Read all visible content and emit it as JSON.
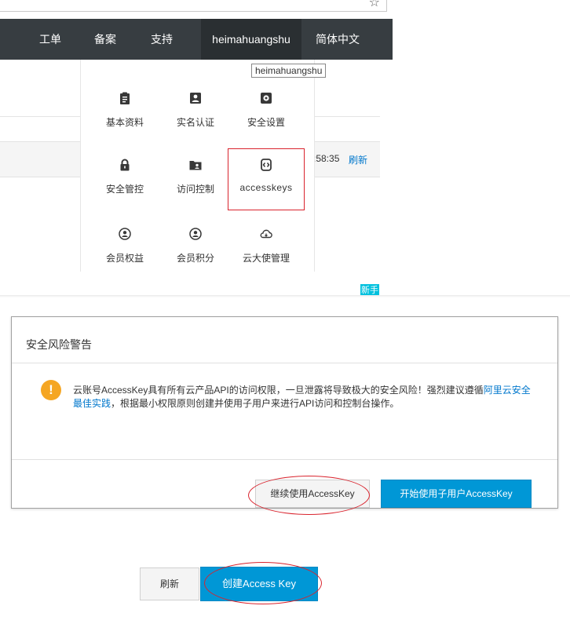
{
  "nav": {
    "items": [
      {
        "label": "工单"
      },
      {
        "label": "备案"
      },
      {
        "label": "支持"
      },
      {
        "label": "heimahuangshu"
      },
      {
        "label": "简体中文"
      }
    ],
    "bg_color": "#373d41"
  },
  "tooltip": "heimahuangshu",
  "menu": [
    {
      "label": "基本资料",
      "icon": "clipboard-icon"
    },
    {
      "label": "实名认证",
      "icon": "id-card-icon"
    },
    {
      "label": "安全设置",
      "icon": "gear-icon"
    },
    {
      "label": "安全管控",
      "icon": "lock-icon"
    },
    {
      "label": "访问控制",
      "icon": "folder-user-icon"
    },
    {
      "label": "accesskeys",
      "icon": "key-code-icon"
    },
    {
      "label": "会员权益",
      "icon": "member-icon"
    },
    {
      "label": "会员积分",
      "icon": "member-points-icon"
    },
    {
      "label": "云大使管理",
      "icon": "cloud-icon"
    }
  ],
  "background_row": {
    "time": ":58:35",
    "refresh": "刷新"
  },
  "new_badge": "新手",
  "dialog": {
    "title": "安全风险警告",
    "warning_icon": "!",
    "text_before_link": "云账号AccessKey具有所有云产品API的访问权限，一旦泄露将导致极大的安全风险！强烈建议遵循",
    "link": "阿里云安全最佳实践",
    "text_after_link": "，根据最小权限原则创建并使用子用户来进行API访问和控制台操作。",
    "continue_button": "继续使用AccessKey",
    "start_button": "开始使用子用户AccessKey"
  },
  "bottom": {
    "refresh_button": "刷新",
    "create_button": "创建Access Key"
  },
  "colors": {
    "primary": "#0097d6",
    "highlight": "#d9232d",
    "warning": "#f5a623",
    "link": "#0077cc"
  }
}
